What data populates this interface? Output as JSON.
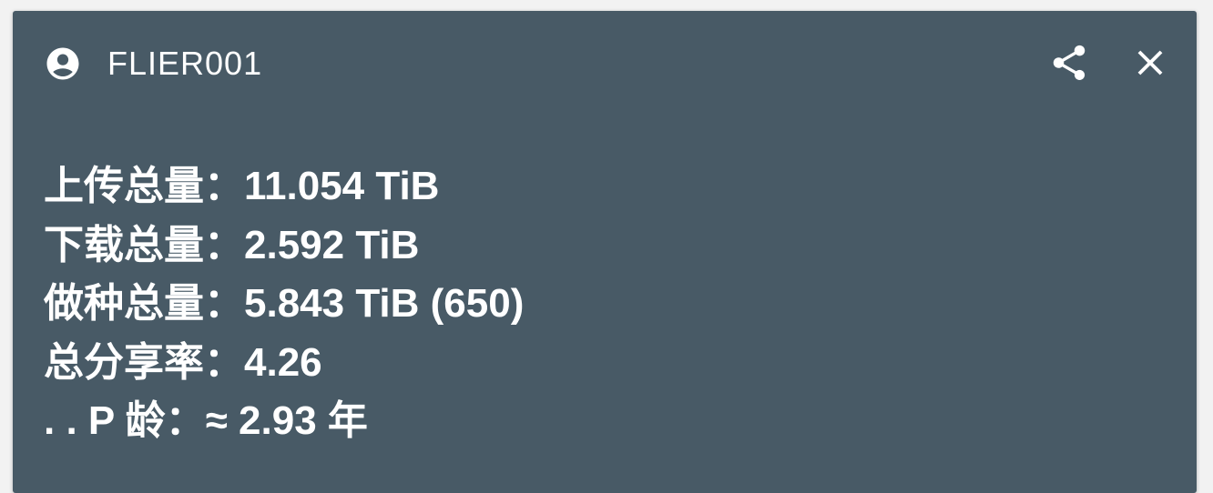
{
  "header": {
    "title": "FLIER001",
    "user_icon": "account-circle-icon",
    "share_icon": "share-icon",
    "close_icon": "close-icon"
  },
  "stats": [
    {
      "label": "上传总量：",
      "value": "11.054 TiB"
    },
    {
      "label": "下载总量：",
      "value": "2.592 TiB"
    },
    {
      "label": "做种总量：",
      "value": "5.843 TiB (650)"
    },
    {
      "label": "总分享率：",
      "value": "4.26"
    },
    {
      "label": ". . P 龄：",
      "value": "≈ 2.93 年"
    }
  ],
  "colors": {
    "card_background": "#485a66",
    "text": "#ffffff",
    "page_background": "#f2f2f2"
  }
}
